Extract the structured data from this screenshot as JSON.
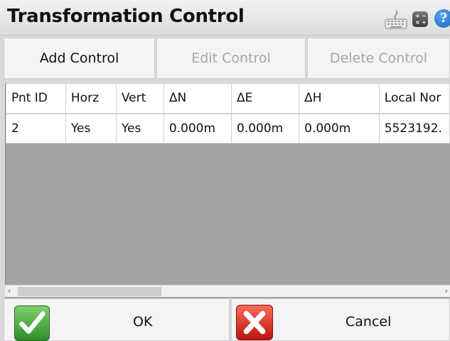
{
  "window": {
    "title": "Transformation Control",
    "icons": [
      "keyboard-icon",
      "calculator-icon",
      "help-icon"
    ],
    "help_glyph": "?"
  },
  "toolbar": {
    "add_label": "Add Control",
    "edit_label": "Edit Control",
    "delete_label": "Delete Control"
  },
  "table": {
    "headers": [
      "Pnt ID",
      "Horz",
      "Vert",
      "ΔN",
      "ΔE",
      "ΔH",
      "Local Nor"
    ],
    "rows": [
      [
        "2",
        "Yes",
        "Yes",
        "0.000m",
        "0.000m",
        "0.000m",
        "5523192."
      ]
    ]
  },
  "scrollbar": {
    "left_arrow": "‹",
    "right_arrow": "›"
  },
  "footer": {
    "ok_label": "OK",
    "cancel_label": "Cancel"
  },
  "colors": {
    "ok_green": "#3aa33a",
    "cancel_red": "#d8221a",
    "disabled_text": "#a6a6a6",
    "grid_empty": "#a3a3a3"
  }
}
